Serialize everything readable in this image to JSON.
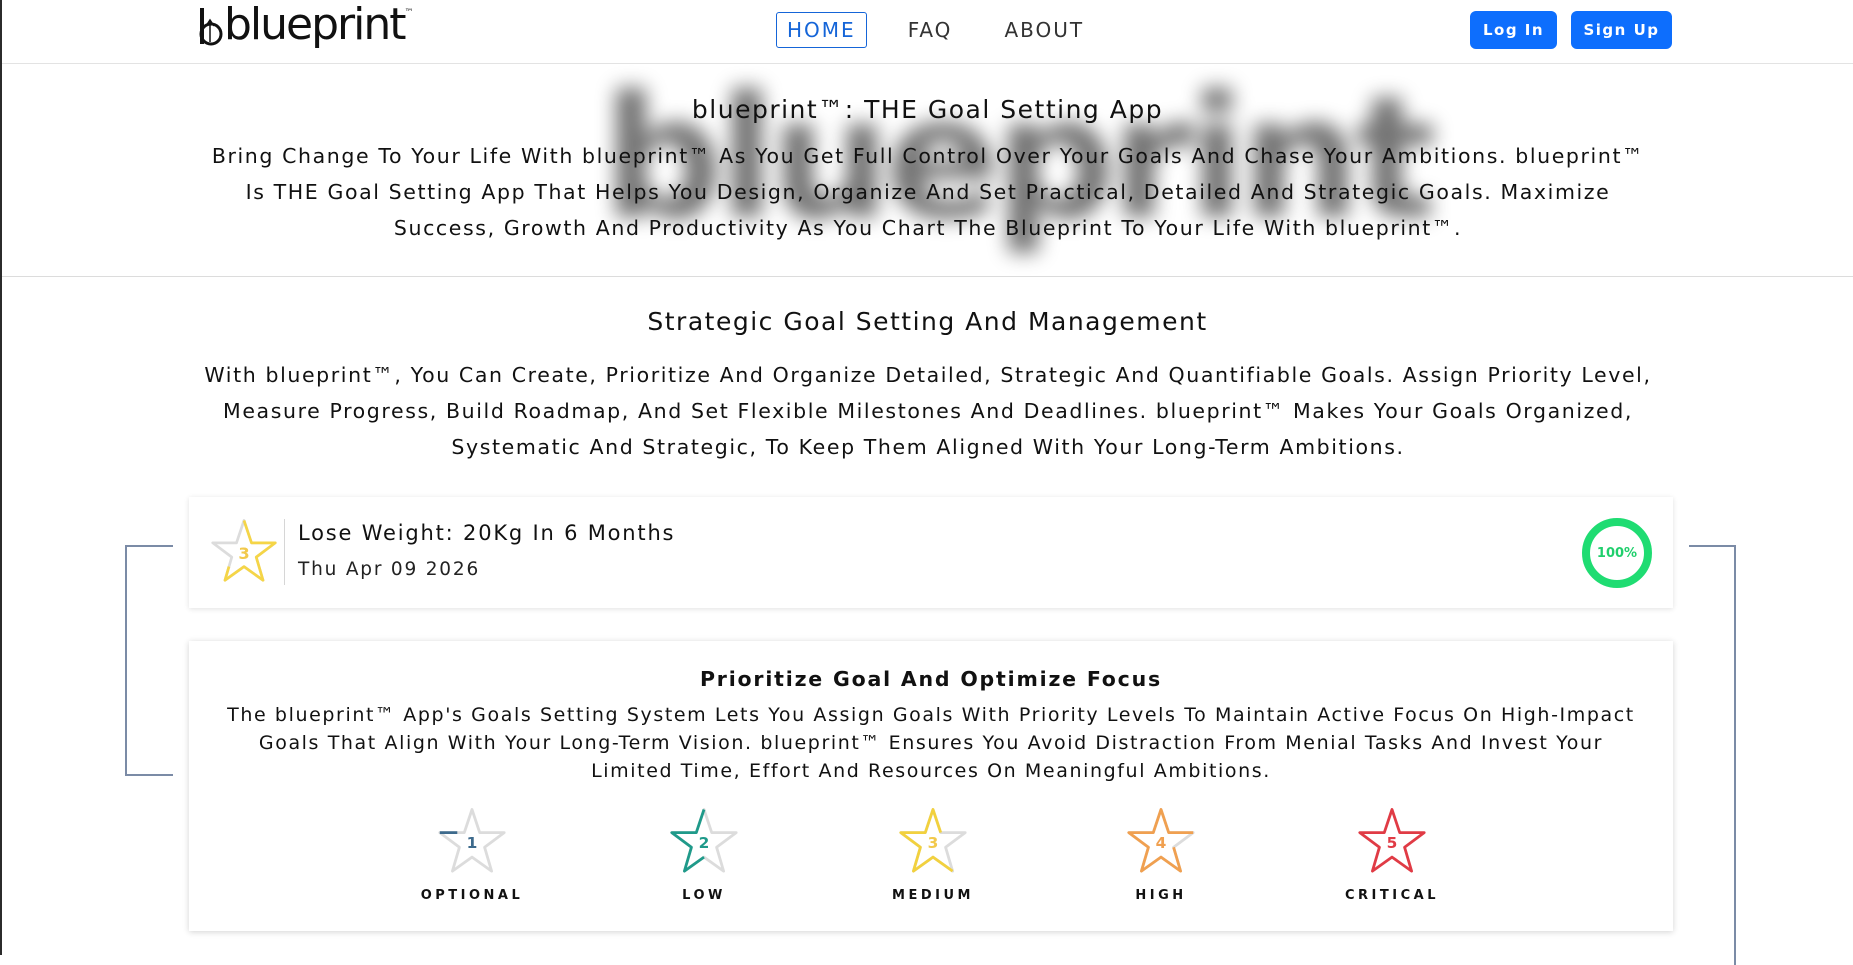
{
  "nav": {
    "logo_text": "blueprint",
    "logo_tm": "™",
    "links": [
      {
        "label": "HOME",
        "active": true
      },
      {
        "label": "FAQ",
        "active": false
      },
      {
        "label": "ABOUT",
        "active": false
      }
    ],
    "login_label": "Log In",
    "signup_label": "Sign Up"
  },
  "hero": {
    "watermark": "blueprint",
    "title": "blueprint™: THE Goal Setting App",
    "text": "Bring Change To Your Life With blueprint™ As You Get Full Control Over Your Goals And Chase Your Ambitions. blueprint™ Is THE Goal Setting App That Helps You Design, Organize And Set Practical, Detailed And Strategic Goals. Maximize Success, Growth And Productivity As You Chart The Blueprint To Your Life With blueprint™."
  },
  "section": {
    "title": "Strategic Goal Setting And Management",
    "text": "With blueprint™, You Can Create, Prioritize And Organize Detailed, Strategic And Quantifiable Goals. Assign Priority Level, Measure Progress, Build Roadmap, And Set Flexible Milestones And Deadlines. blueprint™ Makes Your Goals Organized, Systematic And Strategic, To Keep Them Aligned With Your Long-Term Ambitions."
  },
  "goal": {
    "priority": "3",
    "title": "Lose Weight: 20Kg In 6 Months",
    "date": "Thu Apr 09 2026",
    "progress_label": "100%",
    "progress_value": 1.0,
    "star_color": "#f5d547",
    "progress_color": "#1fdc72"
  },
  "priority_card": {
    "title": "Prioritize Goal And Optimize Focus",
    "text": "The blueprint™ App's Goals Setting System Lets You Assign Goals With Priority Levels To Maintain Active Focus On High-Impact Goals That Align With Your Long-Term Vision. blueprint™ Ensures You Avoid Distraction From Menial Tasks And Invest Your Limited Time, Effort And Resources On Meaningful Ambitions.",
    "levels": [
      {
        "number": "1",
        "label": "OPTIONAL",
        "color": "#3d6a8c",
        "fill": 0.2
      },
      {
        "number": "2",
        "label": "LOW",
        "color": "#1f9a8a",
        "fill": 0.4
      },
      {
        "number": "3",
        "label": "MEDIUM",
        "color": "#f2d13e",
        "fill": 0.6
      },
      {
        "number": "4",
        "label": "HIGH",
        "color": "#f0a050",
        "fill": 0.8
      },
      {
        "number": "5",
        "label": "CRITICAL",
        "color": "#e03b45",
        "fill": 1.0
      }
    ]
  }
}
